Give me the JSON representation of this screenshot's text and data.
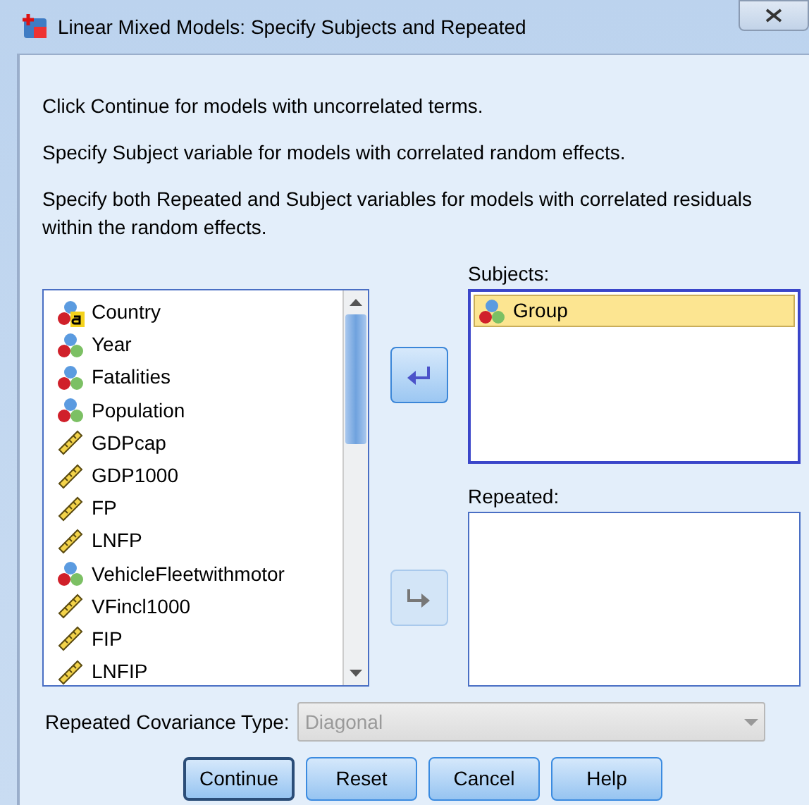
{
  "window": {
    "title": "Linear Mixed Models: Specify Subjects and Repeated"
  },
  "instructions": [
    "Click Continue for models with uncorrelated terms.",
    "Specify Subject variable for models with correlated random effects.",
    "Specify both Repeated and Subject variables for models with correlated residuals within the random effects."
  ],
  "variables": [
    {
      "name": "Country",
      "kind": "string",
      "selected": false
    },
    {
      "name": "Year",
      "kind": "nominal",
      "selected": false
    },
    {
      "name": "Fatalities",
      "kind": "nominal",
      "selected": false
    },
    {
      "name": "Population",
      "kind": "nominal",
      "selected": false
    },
    {
      "name": "GDPcap",
      "kind": "scale",
      "selected": false
    },
    {
      "name": "GDP1000",
      "kind": "scale",
      "selected": false
    },
    {
      "name": "FP",
      "kind": "scale",
      "selected": false
    },
    {
      "name": "LNFP",
      "kind": "scale",
      "selected": false
    },
    {
      "name": "VehicleFleetwithmotor",
      "kind": "nominal",
      "selected": false
    },
    {
      "name": "VFincl1000",
      "kind": "scale",
      "selected": false
    },
    {
      "name": "FIP",
      "kind": "scale",
      "selected": false
    },
    {
      "name": "LNFIP",
      "kind": "scale",
      "selected": false
    }
  ],
  "move_buttons": [
    {
      "kind": "left",
      "disabled": false
    },
    {
      "kind": "right",
      "disabled": true
    }
  ],
  "subjects": {
    "label": "Subjects:",
    "items": [
      {
        "name": "Group",
        "kind": "nominal",
        "selected": true
      }
    ]
  },
  "repeated": {
    "label": "Repeated:"
  },
  "covariance": {
    "label": "Repeated Covariance Type:",
    "value": "Diagonal",
    "disabled": true
  },
  "buttons": [
    {
      "label": "Continue",
      "default": true
    },
    {
      "label": "Reset",
      "default": false
    },
    {
      "label": "Cancel",
      "default": false
    },
    {
      "label": "Help",
      "default": false
    }
  ]
}
